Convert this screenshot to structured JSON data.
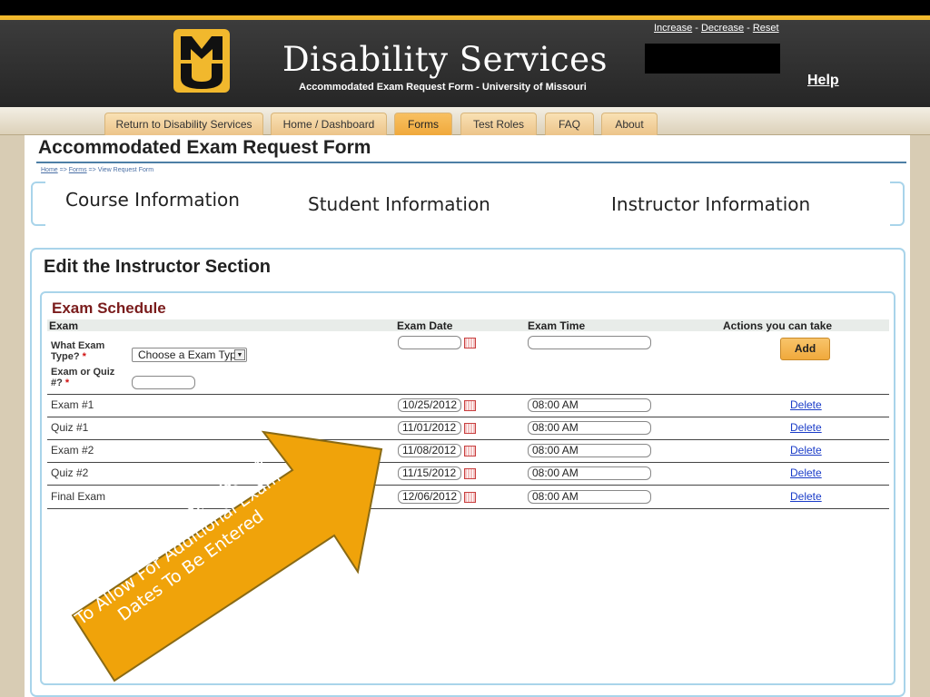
{
  "header": {
    "title": "Disability Services",
    "subtitle": "Accommodated Exam Request Form - University of Missouri",
    "logo_letters": "MU",
    "text_size": {
      "increase": "Increase",
      "decrease": "Decrease",
      "reset": "Reset",
      "separator": " - "
    },
    "help": "Help",
    "colors": {
      "gold": "#f1b82d",
      "black": "#000000"
    }
  },
  "nav": {
    "tabs": [
      {
        "label": "Return to Disability Services"
      },
      {
        "label": "Home / Dashboard"
      },
      {
        "label": "Forms",
        "active": true
      },
      {
        "label": "Test Roles"
      },
      {
        "label": "FAQ"
      },
      {
        "label": "About"
      }
    ]
  },
  "page": {
    "title": "Accommodated Exam Request Form",
    "breadcrumb": [
      "Home",
      "Forms",
      "View Request Form"
    ],
    "breadcrumb_sep": " => ",
    "sections": [
      "Course Information",
      "Student Information",
      "Instructor Information"
    ],
    "panel_title": "Edit the Instructor Section"
  },
  "schedule": {
    "title": "Exam Schedule",
    "columns": {
      "exam": "Exam",
      "date": "Exam Date",
      "time": "Exam Time",
      "actions": "Actions you can take"
    },
    "form": {
      "exam_type_label_1": "What Exam",
      "exam_type_label_2": "Type?",
      "exam_type_value": "Choose a Exam Type",
      "quiz_label_1": "Exam or Quiz",
      "quiz_label_2": "#?",
      "required_mark": "*",
      "add_label": "Add"
    },
    "rows": [
      {
        "name": "Exam #1",
        "date": "10/25/2012",
        "time": "08:00 AM",
        "action": "Delete"
      },
      {
        "name": "Quiz #1",
        "date": "11/01/2012",
        "time": "08:00 AM",
        "action": "Delete"
      },
      {
        "name": "Exam #2",
        "date": "11/08/2012",
        "time": "08:00 AM",
        "action": "Delete"
      },
      {
        "name": "Quiz #2",
        "date": "11/15/2012",
        "time": "08:00 AM",
        "action": "Delete"
      },
      {
        "name": "Final Exam",
        "date": "12/06/2012",
        "time": "08:00 AM",
        "action": "Delete"
      }
    ]
  },
  "callout": {
    "line1": "Exam Date Populates Below",
    "line2": "To Allow For Additional Exam",
    "line3": "Dates To Be Entered",
    "color": "#f0a30a"
  }
}
